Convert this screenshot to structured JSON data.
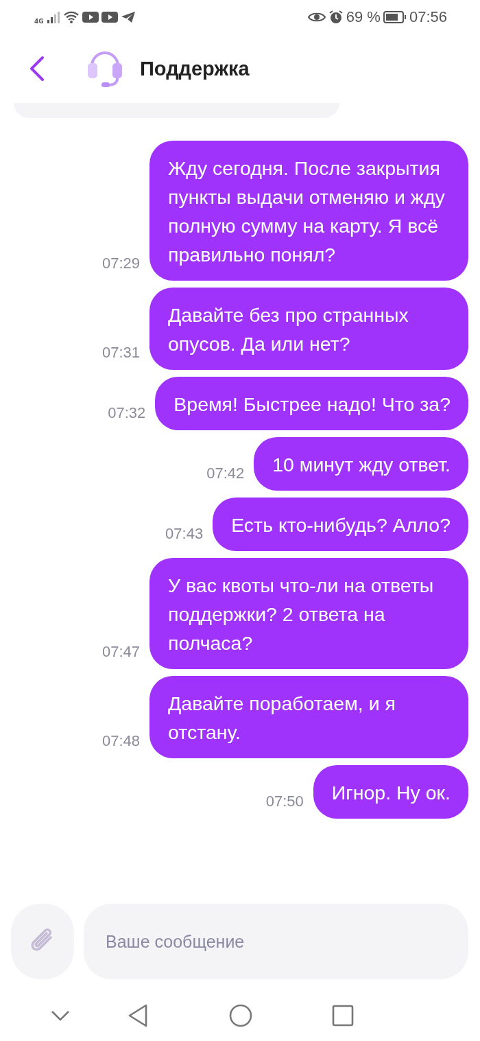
{
  "status_bar": {
    "network": "4G",
    "battery": "69 %",
    "time": "07:56"
  },
  "header": {
    "title": "Поддержка"
  },
  "messages": [
    {
      "text": "Жду сегодня. После закрытия пункты выдачи отменяю и жду полную сумму на карту. Я всё правильно понял?",
      "time": "07:29"
    },
    {
      "text": "Давайте без про странных опусов. Да или нет?",
      "time": "07:31"
    },
    {
      "text": "Время! Быстрее надо! Что за?",
      "time": "07:32"
    },
    {
      "text": "10 минут жду ответ.",
      "time": "07:42"
    },
    {
      "text": "Есть кто-нибудь? Алло?",
      "time": "07:43"
    },
    {
      "text": "У вас квоты что-ли на ответы поддержки? 2 ответа на полчаса?",
      "time": "07:47"
    },
    {
      "text": "Давайте поработаем, и я отстану.",
      "time": "07:48"
    },
    {
      "text": "Игнор. Ну ок.",
      "time": "07:50"
    }
  ],
  "composer": {
    "placeholder": "Ваше сообщение"
  }
}
